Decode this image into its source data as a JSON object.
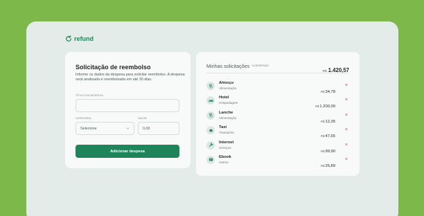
{
  "brand": {
    "name": "refund"
  },
  "form": {
    "title": "Solicitação de reembolso",
    "description": "Informe os dados da despesa para solicitar reembolso. A despesa será analisada e reembolsada em até 30 dias.",
    "expense_title_label": "TÍTULO DA DESPESA",
    "expense_title_value": "",
    "category_label": "CATEGORIA",
    "category_value": "Selecione",
    "amount_label": "VALOR",
    "amount_placeholder": "0,00",
    "submit_label": "Adicionar despesa"
  },
  "list": {
    "title": "Minhas solicitações",
    "separator": "·",
    "count": "6 despesas",
    "total_currency": "R$",
    "total_amount": "1.420,57",
    "items": [
      {
        "name": "Almoço",
        "category": "Alimentação",
        "currency": "R$",
        "value": "34,78",
        "icon": "food-icon"
      },
      {
        "name": "Hotel",
        "category": "Hospedagem",
        "currency": "R$",
        "value": "1.200,00",
        "icon": "bed-icon"
      },
      {
        "name": "Lanche",
        "category": "Alimentação",
        "currency": "R$",
        "value": "12,35",
        "icon": "food-icon"
      },
      {
        "name": "Taxi",
        "category": "Transporte",
        "currency": "R$",
        "value": "47,65",
        "icon": "car-icon"
      },
      {
        "name": "Internet",
        "category": "Serviços",
        "currency": "R$",
        "value": "99,90",
        "icon": "wrench-icon"
      },
      {
        "name": "Ebook",
        "category": "Outros",
        "currency": "R$",
        "value": "25,89",
        "icon": "receipt-icon"
      }
    ],
    "delete_glyph": "×"
  },
  "colors": {
    "background": "#7cb84a",
    "app": "#e4ece9",
    "card": "#f8faf9",
    "brand": "#1f8459",
    "danger": "#d0454c"
  }
}
